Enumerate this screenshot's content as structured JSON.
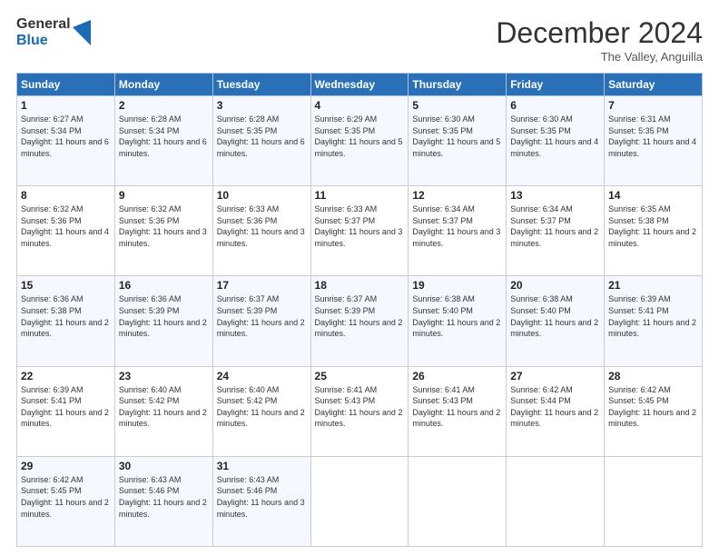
{
  "header": {
    "logo_line1": "General",
    "logo_line2": "Blue",
    "month_title": "December 2024",
    "subtitle": "The Valley, Anguilla"
  },
  "columns": [
    "Sunday",
    "Monday",
    "Tuesday",
    "Wednesday",
    "Thursday",
    "Friday",
    "Saturday"
  ],
  "weeks": [
    [
      {
        "day": "1",
        "sunrise": "Sunrise: 6:27 AM",
        "sunset": "Sunset: 5:34 PM",
        "daylight": "Daylight: 11 hours and 6 minutes."
      },
      {
        "day": "2",
        "sunrise": "Sunrise: 6:28 AM",
        "sunset": "Sunset: 5:34 PM",
        "daylight": "Daylight: 11 hours and 6 minutes."
      },
      {
        "day": "3",
        "sunrise": "Sunrise: 6:28 AM",
        "sunset": "Sunset: 5:35 PM",
        "daylight": "Daylight: 11 hours and 6 minutes."
      },
      {
        "day": "4",
        "sunrise": "Sunrise: 6:29 AM",
        "sunset": "Sunset: 5:35 PM",
        "daylight": "Daylight: 11 hours and 5 minutes."
      },
      {
        "day": "5",
        "sunrise": "Sunrise: 6:30 AM",
        "sunset": "Sunset: 5:35 PM",
        "daylight": "Daylight: 11 hours and 5 minutes."
      },
      {
        "day": "6",
        "sunrise": "Sunrise: 6:30 AM",
        "sunset": "Sunset: 5:35 PM",
        "daylight": "Daylight: 11 hours and 4 minutes."
      },
      {
        "day": "7",
        "sunrise": "Sunrise: 6:31 AM",
        "sunset": "Sunset: 5:35 PM",
        "daylight": "Daylight: 11 hours and 4 minutes."
      }
    ],
    [
      {
        "day": "8",
        "sunrise": "Sunrise: 6:32 AM",
        "sunset": "Sunset: 5:36 PM",
        "daylight": "Daylight: 11 hours and 4 minutes."
      },
      {
        "day": "9",
        "sunrise": "Sunrise: 6:32 AM",
        "sunset": "Sunset: 5:36 PM",
        "daylight": "Daylight: 11 hours and 3 minutes."
      },
      {
        "day": "10",
        "sunrise": "Sunrise: 6:33 AM",
        "sunset": "Sunset: 5:36 PM",
        "daylight": "Daylight: 11 hours and 3 minutes."
      },
      {
        "day": "11",
        "sunrise": "Sunrise: 6:33 AM",
        "sunset": "Sunset: 5:37 PM",
        "daylight": "Daylight: 11 hours and 3 minutes."
      },
      {
        "day": "12",
        "sunrise": "Sunrise: 6:34 AM",
        "sunset": "Sunset: 5:37 PM",
        "daylight": "Daylight: 11 hours and 3 minutes."
      },
      {
        "day": "13",
        "sunrise": "Sunrise: 6:34 AM",
        "sunset": "Sunset: 5:37 PM",
        "daylight": "Daylight: 11 hours and 2 minutes."
      },
      {
        "day": "14",
        "sunrise": "Sunrise: 6:35 AM",
        "sunset": "Sunset: 5:38 PM",
        "daylight": "Daylight: 11 hours and 2 minutes."
      }
    ],
    [
      {
        "day": "15",
        "sunrise": "Sunrise: 6:36 AM",
        "sunset": "Sunset: 5:38 PM",
        "daylight": "Daylight: 11 hours and 2 minutes."
      },
      {
        "day": "16",
        "sunrise": "Sunrise: 6:36 AM",
        "sunset": "Sunset: 5:39 PM",
        "daylight": "Daylight: 11 hours and 2 minutes."
      },
      {
        "day": "17",
        "sunrise": "Sunrise: 6:37 AM",
        "sunset": "Sunset: 5:39 PM",
        "daylight": "Daylight: 11 hours and 2 minutes."
      },
      {
        "day": "18",
        "sunrise": "Sunrise: 6:37 AM",
        "sunset": "Sunset: 5:39 PM",
        "daylight": "Daylight: 11 hours and 2 minutes."
      },
      {
        "day": "19",
        "sunrise": "Sunrise: 6:38 AM",
        "sunset": "Sunset: 5:40 PM",
        "daylight": "Daylight: 11 hours and 2 minutes."
      },
      {
        "day": "20",
        "sunrise": "Sunrise: 6:38 AM",
        "sunset": "Sunset: 5:40 PM",
        "daylight": "Daylight: 11 hours and 2 minutes."
      },
      {
        "day": "21",
        "sunrise": "Sunrise: 6:39 AM",
        "sunset": "Sunset: 5:41 PM",
        "daylight": "Daylight: 11 hours and 2 minutes."
      }
    ],
    [
      {
        "day": "22",
        "sunrise": "Sunrise: 6:39 AM",
        "sunset": "Sunset: 5:41 PM",
        "daylight": "Daylight: 11 hours and 2 minutes."
      },
      {
        "day": "23",
        "sunrise": "Sunrise: 6:40 AM",
        "sunset": "Sunset: 5:42 PM",
        "daylight": "Daylight: 11 hours and 2 minutes."
      },
      {
        "day": "24",
        "sunrise": "Sunrise: 6:40 AM",
        "sunset": "Sunset: 5:42 PM",
        "daylight": "Daylight: 11 hours and 2 minutes."
      },
      {
        "day": "25",
        "sunrise": "Sunrise: 6:41 AM",
        "sunset": "Sunset: 5:43 PM",
        "daylight": "Daylight: 11 hours and 2 minutes."
      },
      {
        "day": "26",
        "sunrise": "Sunrise: 6:41 AM",
        "sunset": "Sunset: 5:43 PM",
        "daylight": "Daylight: 11 hours and 2 minutes."
      },
      {
        "day": "27",
        "sunrise": "Sunrise: 6:42 AM",
        "sunset": "Sunset: 5:44 PM",
        "daylight": "Daylight: 11 hours and 2 minutes."
      },
      {
        "day": "28",
        "sunrise": "Sunrise: 6:42 AM",
        "sunset": "Sunset: 5:45 PM",
        "daylight": "Daylight: 11 hours and 2 minutes."
      }
    ],
    [
      {
        "day": "29",
        "sunrise": "Sunrise: 6:42 AM",
        "sunset": "Sunset: 5:45 PM",
        "daylight": "Daylight: 11 hours and 2 minutes."
      },
      {
        "day": "30",
        "sunrise": "Sunrise: 6:43 AM",
        "sunset": "Sunset: 5:46 PM",
        "daylight": "Daylight: 11 hours and 2 minutes."
      },
      {
        "day": "31",
        "sunrise": "Sunrise: 6:43 AM",
        "sunset": "Sunset: 5:46 PM",
        "daylight": "Daylight: 11 hours and 3 minutes."
      },
      null,
      null,
      null,
      null
    ]
  ]
}
